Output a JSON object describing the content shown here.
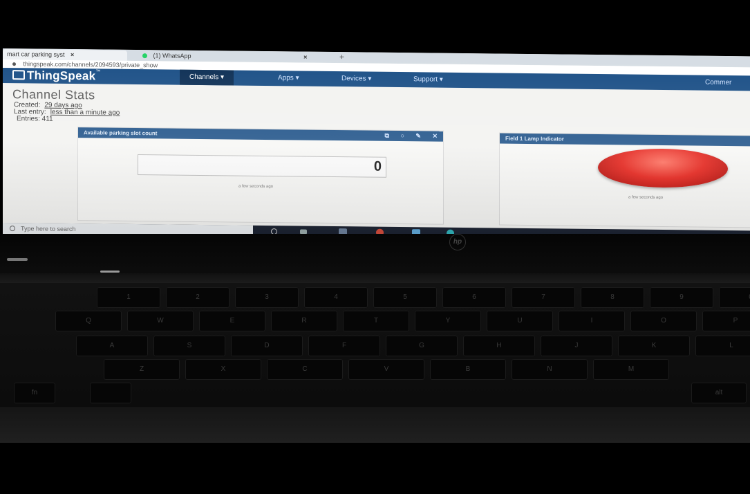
{
  "browser": {
    "tabs": [
      {
        "label": "mart car parking syst",
        "close": "×"
      },
      {
        "label": "(1) WhatsApp",
        "close": "×"
      }
    ],
    "new_tab": "+",
    "url": "thingspeak.com/channels/2094593/private_show"
  },
  "nav": {
    "logo": "ThingSpeak",
    "logo_tm": "™",
    "items": [
      "Channels ▾",
      "Apps ▾",
      "Devices ▾",
      "Support ▾",
      "Commer"
    ]
  },
  "channel": {
    "title": "Channel Stats",
    "created_label": "Created:",
    "created_value": "29 days ago",
    "last_entry_label": "Last entry:",
    "last_entry_value": "less than a minute ago",
    "entries": "Entries: 411"
  },
  "widgets": {
    "slot": {
      "title": "Available parking slot count",
      "value": "0",
      "updated": "a few seconds ago"
    },
    "lamp": {
      "title": "Field 1 Lamp Indicator",
      "updated": "a few seconds ago",
      "color": "#e52018"
    }
  },
  "taskbar": {
    "search_placeholder": "Type here to search"
  },
  "laptop": {
    "brand": "hp",
    "keys_row1": [
      "1",
      "2",
      "3",
      "4",
      "5",
      "6",
      "7",
      "8",
      "9",
      "0"
    ],
    "keys_row2": [
      "Q",
      "W",
      "E",
      "R",
      "T",
      "Y",
      "U",
      "I",
      "O",
      "P"
    ],
    "keys_row3": [
      "A",
      "S",
      "D",
      "F",
      "G",
      "H",
      "J",
      "K",
      "L"
    ],
    "keys_row4": [
      "Z",
      "X",
      "C",
      "V",
      "B",
      "N",
      "M"
    ],
    "fn_key": "fn",
    "alt_key": "alt"
  }
}
